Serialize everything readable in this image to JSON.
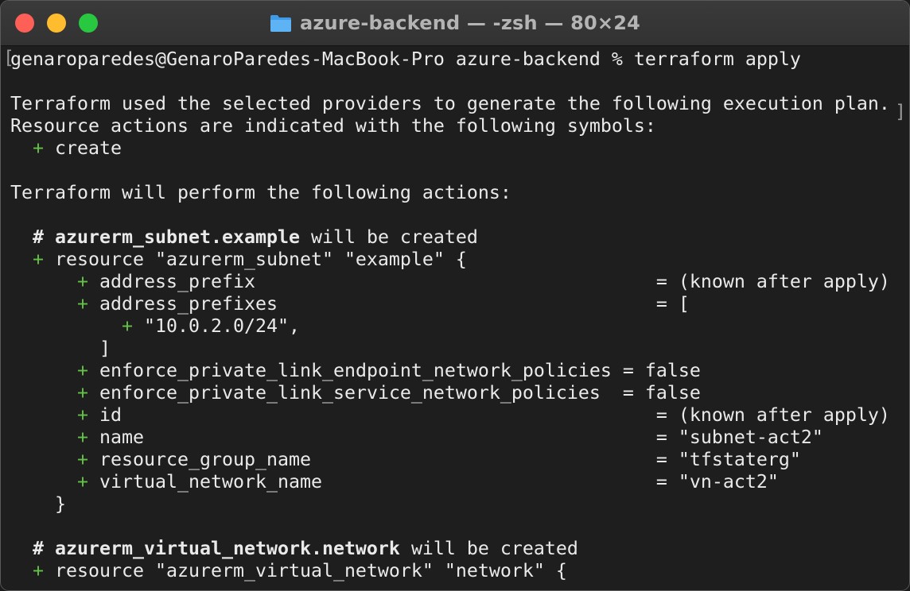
{
  "window": {
    "title": "azure-backend — -zsh — 80×24",
    "traffic_lights": {
      "close_color": "#fe5f57",
      "minimize_color": "#febc2e",
      "zoom_color": "#28c840"
    },
    "title_icon": "folder-icon",
    "left_bracket": "[",
    "right_bracket": "]"
  },
  "colors": {
    "background": "#1e1e1e",
    "text": "#eaeaea",
    "plus": "#64c046"
  },
  "terminal": {
    "prompt": "genaroparedes@GenaroParedes-MacBook-Pro azure-backend % terraform apply",
    "intro_1": "Terraform used the selected providers to generate the following execution plan.",
    "intro_2": "Resource actions are indicated with the following symbols:",
    "symbol_plus": "+",
    "symbol_create": "create",
    "actions_header": "Terraform will perform the following actions:",
    "subnet": {
      "comment_hash": "#",
      "comment_resource": "azurerm_subnet.example",
      "comment_suffix": "will be created",
      "resource_line": "resource \"azurerm_subnet\" \"example\" {",
      "attributes": [
        {
          "key": "address_prefix                                    ",
          "value": "= (known after apply)"
        },
        {
          "key": "address_prefixes                                  ",
          "value": "= ["
        },
        {
          "key": "\"10.0.2.0/24\",",
          "value": ""
        },
        {
          "key": "]",
          "value": ""
        },
        {
          "key": "enforce_private_link_endpoint_network_policies",
          "value": " = false"
        },
        {
          "key": "enforce_private_link_service_network_policies ",
          "value": " = false"
        },
        {
          "key": "id                                                ",
          "value": "= (known after apply)"
        },
        {
          "key": "name                                              ",
          "value": "= \"subnet-act2\""
        },
        {
          "key": "resource_group_name                               ",
          "value": "= \"tfstaterg\""
        },
        {
          "key": "virtual_network_name                              ",
          "value": "= \"vn-act2\""
        }
      ],
      "close_brace": "}"
    },
    "vnet": {
      "comment_hash": "#",
      "comment_resource": "azurerm_virtual_network.network",
      "comment_suffix": "will be created",
      "resource_line": "resource \"azurerm_virtual_network\" \"network\" {"
    }
  }
}
